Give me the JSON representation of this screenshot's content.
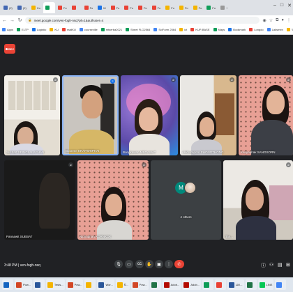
{
  "browser": {
    "tabs": [
      {
        "label": "(2)",
        "color": "#4267b2",
        "active": false
      },
      {
        "label": "(2)",
        "color": "#4267b2",
        "active": false
      },
      {
        "label": "Co",
        "color": "#f4b400",
        "active": false
      },
      {
        "label": "",
        "color": "#0f9d58",
        "active": true
      },
      {
        "label": "Fo",
        "color": "#e94235",
        "active": false
      },
      {
        "label": "",
        "color": "#e94235",
        "active": false
      },
      {
        "label": "Fo",
        "color": "#e94235",
        "active": false
      },
      {
        "label": "M",
        "color": "#1a73e8",
        "active": false
      },
      {
        "label": "Fo",
        "color": "#e94235",
        "active": false
      },
      {
        "label": "Fo",
        "color": "#e94235",
        "active": false
      },
      {
        "label": "Fo",
        "color": "#e94235",
        "active": false
      },
      {
        "label": "Fo",
        "color": "#e94235",
        "active": false
      },
      {
        "label": "Fo",
        "color": "#f4b400",
        "active": false
      },
      {
        "label": "Fo",
        "color": "#f4b400",
        "active": false
      },
      {
        "label": "Fo",
        "color": "#f4b400",
        "active": false
      },
      {
        "label": "Fo",
        "color": "#0f9d58",
        "active": false
      },
      {
        "label": "+",
        "color": "#999999",
        "active": false
      }
    ],
    "url": "meet.google.com/ven-fogh-nsq?pli=1&authuser=4",
    "bookmarks": [
      {
        "label": "Apps",
        "color": "#4285f4"
      },
      {
        "label": "ELTP",
        "color": "#0f9d58"
      },
      {
        "label": "Logistic",
        "color": "#1a73e8"
      },
      {
        "label": "KU",
        "color": "#f4b400"
      },
      {
        "label": "mailKU",
        "color": "#e94235"
      },
      {
        "label": "courseville",
        "color": "#4285f4"
      },
      {
        "label": "mtserba2021",
        "color": "#0f9d58"
      },
      {
        "label": "Sheet FLO2564",
        "color": "#0f9d58"
      },
      {
        "label": "SciForm 2564",
        "color": "#4285f4"
      },
      {
        "label": "ict",
        "color": "#f4b400"
      },
      {
        "label": "KUP-BASE",
        "color": "#e94235"
      },
      {
        "label": "Maps",
        "color": "#0f9d58"
      },
      {
        "label": "Bookmark",
        "color": "#1a73e8"
      },
      {
        "label": "Longdo",
        "color": "#e94235"
      },
      {
        "label": "Laksmen",
        "color": "#4285f4"
      },
      {
        "label": "ระบบงบ",
        "color": "#f4b400"
      },
      {
        "label": "Other",
        "color": "#f4b400"
      }
    ]
  },
  "meet": {
    "rec_label": "REC",
    "time": "3:48 PM",
    "meeting_code": "ven-fogh-nsq",
    "participants": [
      {
        "name": "Suchart SEINGLALAPHAN",
        "row": 0
      },
      {
        "name": "Boonme KRAPSRIPHAI",
        "row": 0
      },
      {
        "name": "Bongkawan MEGAWAT",
        "row": 0
      },
      {
        "name": "Akkharaporn PHONGTHONG",
        "row": 0
      },
      {
        "name": "Kanyaphak SANGSORN",
        "row": 0
      },
      {
        "name": "Pannawit SUEBAT",
        "row": 1
      },
      {
        "name": "Niphaphan KORNKOK",
        "row": 1
      },
      {
        "name": "Tan...",
        "row": 1
      }
    ],
    "others": {
      "label": "4 others",
      "initial": "M",
      "avatar_color": "#00897b"
    },
    "controls": [
      "mic",
      "camera",
      "captions",
      "raise-hand",
      "present",
      "more",
      "leave-call"
    ],
    "right_controls": [
      "info",
      "people",
      "chat",
      "activities"
    ]
  },
  "taskbar": {
    "items": [
      {
        "label": "",
        "color": "#1565c0"
      },
      {
        "label": "Pow...",
        "color": "#d24726"
      },
      {
        "label": "",
        "color": "#2b579a"
      },
      {
        "label": "Tests...",
        "color": "#f4b400"
      },
      {
        "label": "Pow...",
        "color": "#d24726"
      },
      {
        "label": "",
        "color": "#f4b400"
      },
      {
        "label": "Wor...",
        "color": "#2b579a"
      },
      {
        "label": "ปั...",
        "color": "#f4b400"
      },
      {
        "label": "Pow...",
        "color": "#d24726"
      },
      {
        "label": "",
        "color": "#217346"
      },
      {
        "label": "Adob...",
        "color": "#b30b00"
      },
      {
        "label": "Adob...",
        "color": "#b30b00"
      },
      {
        "label": "",
        "color": "#0f9d58"
      },
      {
        "label": "",
        "color": "#e94235"
      },
      {
        "label": "เอก...",
        "color": "#2b579a"
      },
      {
        "label": "",
        "color": "#217346"
      },
      {
        "label": "LINE",
        "color": "#06c755"
      },
      {
        "label": "",
        "color": "#4285f4"
      }
    ]
  }
}
